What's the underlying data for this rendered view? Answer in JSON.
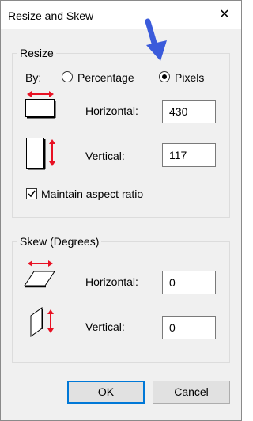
{
  "window": {
    "title": "Resize and Skew",
    "close_glyph": "✕"
  },
  "resize": {
    "legend": "Resize",
    "by_label": "By:",
    "options": [
      {
        "label": "Percentage",
        "selected": false
      },
      {
        "label": "Pixels",
        "selected": true
      }
    ],
    "horizontal_label": "Horizontal:",
    "horizontal_value": "430",
    "vertical_label": "Vertical:",
    "vertical_value": "117",
    "aspect_label": "Maintain aspect ratio",
    "aspect_checked": true
  },
  "skew": {
    "legend": "Skew (Degrees)",
    "horizontal_label": "Horizontal:",
    "horizontal_value": "0",
    "vertical_label": "Vertical:",
    "vertical_value": "0"
  },
  "buttons": {
    "ok": "OK",
    "cancel": "Cancel"
  },
  "colors": {
    "accent": "#0078d7",
    "annotation_arrow": "#3b5bdb",
    "icon_arrow": "#e81123"
  },
  "icons": {
    "close": "close-icon",
    "resize_horizontal": "resize-horizontal-icon",
    "resize_vertical": "resize-vertical-icon",
    "skew_horizontal": "skew-horizontal-icon",
    "skew_vertical": "skew-vertical-icon",
    "annotation": "blue-down-arrow-icon"
  }
}
